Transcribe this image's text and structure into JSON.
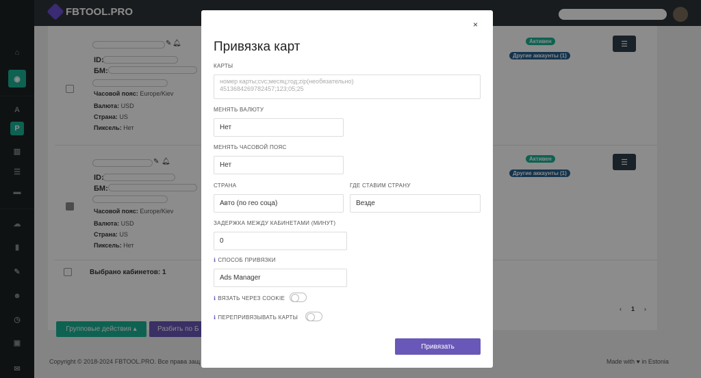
{
  "app": {
    "brand": "FBTOOL.PRO"
  },
  "sidebar": {
    "items": [
      "home-icon",
      "user-icon",
      "A",
      "P",
      "columns-icon",
      "list-icon",
      "folder-icon",
      "cloud-icon",
      "chart-icon",
      "edit-icon",
      "users-icon",
      "clock-icon",
      "money-icon",
      "chat-icon"
    ]
  },
  "rows": [
    {
      "id_label": "ID:",
      "bm_label": "БМ:",
      "timezone_label": "Часовой пояс:",
      "timezone": "Europe/Kiev",
      "currency_label": "Валюта:",
      "currency": "USD",
      "country_label": "Страна:",
      "country": "US",
      "pixel_label": "Пиксель:",
      "pixel": "Нет",
      "status": "Активен",
      "other_accounts": "Другие аккаунты (1)",
      "checked": false
    },
    {
      "id_label": "ID:",
      "bm_label": "БМ:",
      "timezone_label": "Часовой пояс:",
      "timezone": "Europe/Kiev",
      "currency_label": "Валюта:",
      "currency": "USD",
      "country_label": "Страна:",
      "country": "US",
      "pixel_label": "Пиксель:",
      "pixel": "Нет",
      "status": "Активен",
      "other_accounts": "Другие аккаунты (1)",
      "checked": true
    }
  ],
  "selected_count": "Выбрано кабинетов: 1",
  "actions": {
    "group": "Групповые действия ▴",
    "split": "Разбить по Б"
  },
  "pagination": {
    "prev": "‹",
    "page": "1",
    "next": "›"
  },
  "footer": {
    "copyright": "Copyright © 2018-2024 FBTOOL.PRO. Все права защ",
    "made_with": "Made with ♥ in Estonia"
  },
  "modal": {
    "close": "×",
    "title": "Привязка карт",
    "cards_label": "КАРТЫ",
    "cards_placeholder": "номер карты;cvc;месяц;год;zip(необязательно)\n4513684269782457;123;05;25",
    "currency_label": "МЕНЯТЬ ВАЛЮТУ",
    "currency_value": "Нет",
    "timezone_label": "МЕНЯТЬ ЧАСОВОЙ ПОЯС",
    "timezone_value": "Нет",
    "country_label": "СТРАНА",
    "country_value": "Авто (по гео соца)",
    "where_label": "ГДЕ СТАВИМ СТРАНУ",
    "where_value": "Везде",
    "delay_label": "ЗАДЕРЖКА МЕЖДУ КАБИНЕТАМИ (МИНУТ)",
    "delay_value": "0",
    "method_label": "СПОСОБ ПРИВЯЗКИ",
    "method_value": "Ads Manager",
    "cookie_label": "ВЯЗАТЬ ЧЕРЕЗ COOKIE",
    "cookie_on": false,
    "rebind_label": "ПЕРЕПРИВЯЗЫВАТЬ КАРТЫ",
    "rebind_on": false,
    "submit": "Привязать"
  }
}
